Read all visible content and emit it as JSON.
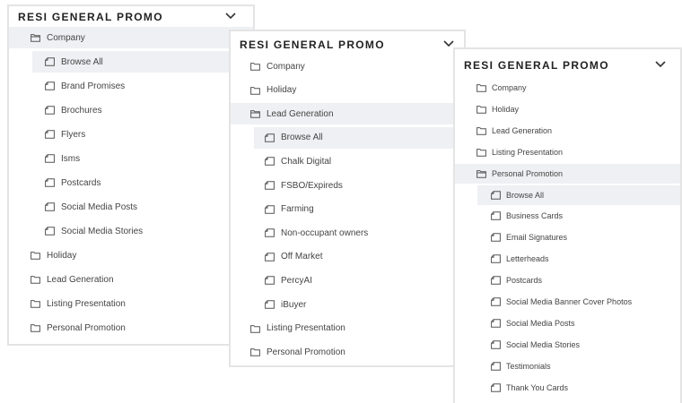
{
  "panel1": {
    "title": "RESI GENERAL PROMO",
    "items": [
      {
        "label": "Company",
        "icon": "folder-open-icon",
        "level": 0,
        "selected": true
      },
      {
        "label": "Browse All",
        "icon": "tag-icon",
        "level": 1,
        "selected": true
      },
      {
        "label": "Brand Promises",
        "icon": "tag-icon",
        "level": 1
      },
      {
        "label": "Brochures",
        "icon": "tag-icon",
        "level": 1
      },
      {
        "label": "Flyers",
        "icon": "tag-icon",
        "level": 1
      },
      {
        "label": "Isms",
        "icon": "tag-icon",
        "level": 1
      },
      {
        "label": "Postcards",
        "icon": "tag-icon",
        "level": 1
      },
      {
        "label": "Social Media Posts",
        "icon": "tag-icon",
        "level": 1
      },
      {
        "label": "Social Media Stories",
        "icon": "tag-icon",
        "level": 1
      },
      {
        "label": "Holiday",
        "icon": "folder-icon",
        "level": 0
      },
      {
        "label": "Lead Generation",
        "icon": "folder-icon",
        "level": 0
      },
      {
        "label": "Listing Presentation",
        "icon": "folder-icon",
        "level": 0
      },
      {
        "label": "Personal Promotion",
        "icon": "folder-icon",
        "level": 0
      }
    ]
  },
  "panel2": {
    "title": "RESI GENERAL PROMO",
    "items": [
      {
        "label": "Company",
        "icon": "folder-icon",
        "level": 0
      },
      {
        "label": "Holiday",
        "icon": "folder-icon",
        "level": 0
      },
      {
        "label": "Lead Generation",
        "icon": "folder-open-icon",
        "level": 0,
        "selected": true
      },
      {
        "label": "Browse All",
        "icon": "tag-icon",
        "level": 1,
        "selected": true
      },
      {
        "label": "Chalk Digital",
        "icon": "tag-icon",
        "level": 1
      },
      {
        "label": "FSBO/Expireds",
        "icon": "tag-icon",
        "level": 1
      },
      {
        "label": "Farming",
        "icon": "tag-icon",
        "level": 1
      },
      {
        "label": "Non-occupant owners",
        "icon": "tag-icon",
        "level": 1
      },
      {
        "label": "Off Market",
        "icon": "tag-icon",
        "level": 1
      },
      {
        "label": "PercyAI",
        "icon": "tag-icon",
        "level": 1
      },
      {
        "label": "iBuyer",
        "icon": "tag-icon",
        "level": 1
      },
      {
        "label": "Listing Presentation",
        "icon": "folder-icon",
        "level": 0
      },
      {
        "label": "Personal Promotion",
        "icon": "folder-icon",
        "level": 0
      }
    ]
  },
  "panel3": {
    "title": "RESI GENERAL PROMO",
    "items": [
      {
        "label": "Company",
        "icon": "folder-icon",
        "level": 0
      },
      {
        "label": "Holiday",
        "icon": "folder-icon",
        "level": 0
      },
      {
        "label": "Lead Generation",
        "icon": "folder-icon",
        "level": 0
      },
      {
        "label": "Listing Presentation",
        "icon": "folder-icon",
        "level": 0
      },
      {
        "label": "Personal Promotion",
        "icon": "folder-open-icon",
        "level": 0,
        "selected": true
      },
      {
        "label": "Browse All",
        "icon": "tag-icon",
        "level": 1,
        "selected": true
      },
      {
        "label": "Business Cards",
        "icon": "tag-icon",
        "level": 1
      },
      {
        "label": "Email Signatures",
        "icon": "tag-icon",
        "level": 1
      },
      {
        "label": "Letterheads",
        "icon": "tag-icon",
        "level": 1
      },
      {
        "label": "Postcards",
        "icon": "tag-icon",
        "level": 1
      },
      {
        "label": "Social Media Banner Cover Photos",
        "icon": "tag-icon",
        "level": 1
      },
      {
        "label": "Social Media Posts",
        "icon": "tag-icon",
        "level": 1
      },
      {
        "label": "Social Media Stories",
        "icon": "tag-icon",
        "level": 1
      },
      {
        "label": "Testimonials",
        "icon": "tag-icon",
        "level": 1
      },
      {
        "label": "Thank You Cards",
        "icon": "tag-icon",
        "level": 1
      }
    ]
  },
  "colors": {
    "border": "#e4e4e4",
    "selected_bg": "#eef0f3",
    "text": "#444444",
    "title": "#222222"
  }
}
